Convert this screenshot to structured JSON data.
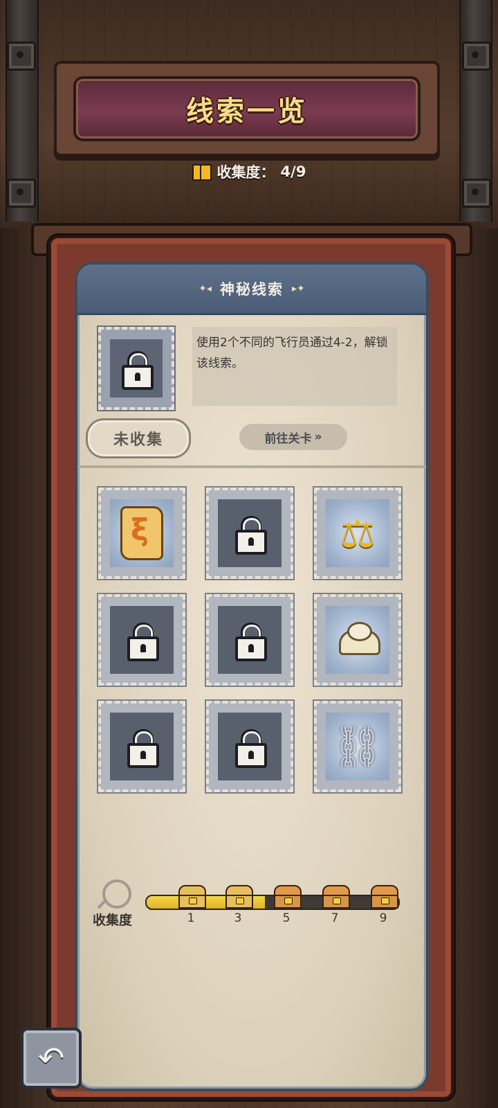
{
  "header": {
    "title": "线索一览",
    "progress_label": "收集度：",
    "progress_value": "4/9"
  },
  "panel": {
    "title": "神秘线索",
    "selected": {
      "description": "使用2个不同的飞行员通过4-2，解锁该线索。",
      "status": "未收集",
      "goto_label": "前往关卡",
      "goto_arrow": "»"
    }
  },
  "clues": [
    {
      "state": "unlocked",
      "icon": "scroll-icon"
    },
    {
      "state": "locked",
      "icon": "lock-icon"
    },
    {
      "state": "unlocked",
      "icon": "scale-icon"
    },
    {
      "state": "locked",
      "icon": "lock-icon"
    },
    {
      "state": "locked",
      "icon": "lock-icon"
    },
    {
      "state": "unlocked",
      "icon": "cloth-icon"
    },
    {
      "state": "locked",
      "icon": "lock-icon"
    },
    {
      "state": "locked",
      "icon": "lock-icon"
    },
    {
      "state": "unlocked",
      "icon": "broken-chain-icon"
    }
  ],
  "collection": {
    "label": "收集度",
    "progress_fraction": 0.47,
    "milestones": [
      {
        "value": "1",
        "reached": true
      },
      {
        "value": "3",
        "reached": true
      },
      {
        "value": "5",
        "reached": false
      },
      {
        "value": "7",
        "reached": false
      },
      {
        "value": "9",
        "reached": false
      }
    ]
  },
  "icons": {
    "back": "back-arrow-icon",
    "magnifier": "magnifier-icon",
    "book": "book-icon",
    "scale_glyph": "⚖",
    "chain_glyph": "⛓",
    "back_glyph": "↶"
  },
  "colors": {
    "title_gold": "#f5dc8a",
    "panel_header": "#5f718a",
    "bar_fill": "#e1b126",
    "frame_red": "#7c3a2e"
  }
}
